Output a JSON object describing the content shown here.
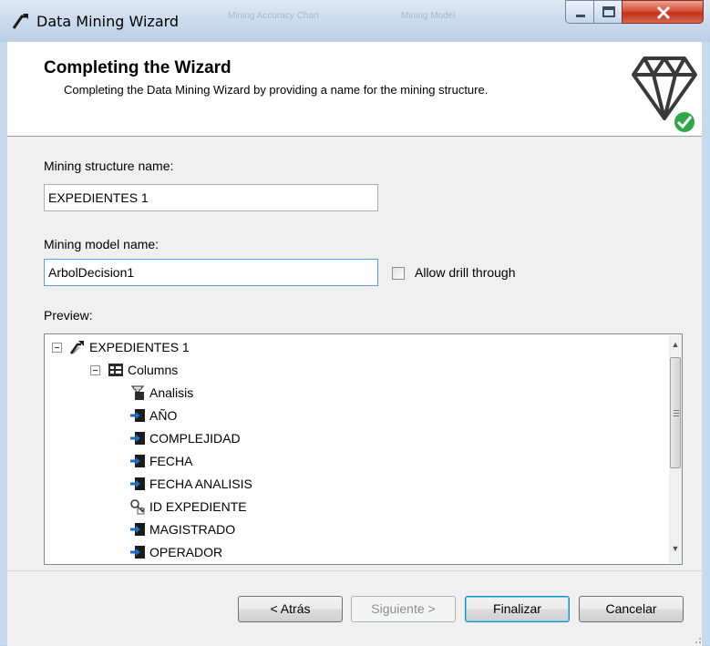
{
  "window": {
    "title": "Data Mining Wizard",
    "ghost_tab_1": "Mining Accuracy Chart",
    "ghost_tab_2": "Mining Model"
  },
  "header": {
    "title": "Completing the Wizard",
    "description": "Completing the Data Mining Wizard by providing a name for the mining structure."
  },
  "form": {
    "structure_label": "Mining structure name:",
    "structure_value": "EXPEDIENTES 1",
    "model_label": "Mining model name:",
    "model_value": "ArbolDecision1",
    "drill_through_label": "Allow drill through",
    "drill_through_checked": false,
    "preview_label": "Preview:"
  },
  "tree": {
    "root": "EXPEDIENTES 1",
    "columns_node": "Columns",
    "columns": [
      {
        "name": "Analisis",
        "icon": "predict-icon"
      },
      {
        "name": "AÑO",
        "icon": "input-arrow-icon"
      },
      {
        "name": "COMPLEJIDAD",
        "icon": "input-arrow-icon"
      },
      {
        "name": "FECHA",
        "icon": "input-arrow-icon"
      },
      {
        "name": "FECHA ANALISIS",
        "icon": "input-arrow-icon"
      },
      {
        "name": "ID EXPEDIENTE",
        "icon": "key-icon"
      },
      {
        "name": "MAGISTRADO",
        "icon": "input-arrow-icon"
      },
      {
        "name": "OPERADOR",
        "icon": "input-arrow-icon"
      }
    ]
  },
  "buttons": {
    "back": "< Atrás",
    "next": "Siguiente >",
    "finish": "Finalizar",
    "cancel": "Cancelar"
  },
  "colors": {
    "accent_check": "#2ea84a",
    "input_arrow": "#1a6fc4"
  }
}
